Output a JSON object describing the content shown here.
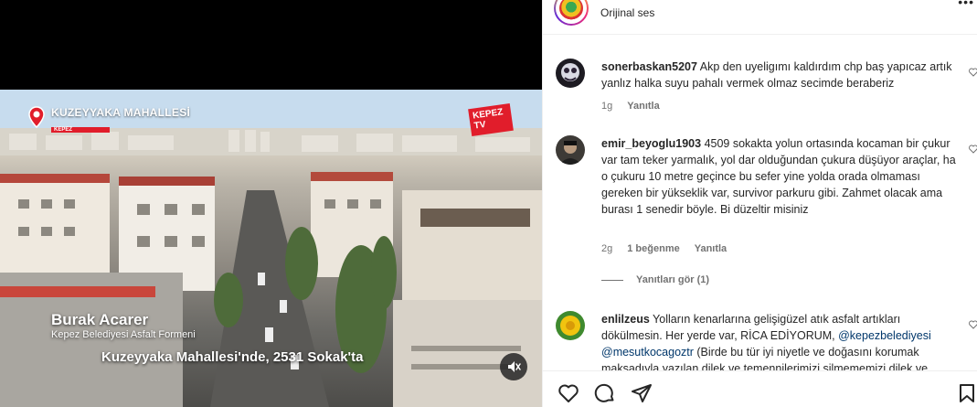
{
  "video": {
    "location_title": "KUZEYYAKA MAHALLESİ",
    "location_sub": "KEPEZ",
    "tv_logo_line1": "KEPEZ",
    "tv_logo_line2": "TV",
    "speaker_name": "Burak Acarer",
    "speaker_role": "Kepez Belediyesi Asfalt Formeni",
    "caption": "Kuzeyyaka Mahallesi'nde, 2531 Sokak'ta"
  },
  "header": {
    "audio_label": "Orijinal ses"
  },
  "comments": [
    {
      "username": "sonerbaskan5207",
      "text": "Akp den uyeligımı kaldırdım chp baş yapıcaz artık yanlız halka suyu pahalı vermek olmaz secimde beraberiz",
      "time": "1g",
      "reply_label": "Yanıtla"
    },
    {
      "username": "emir_beyoglu1903",
      "text": "4509 sokakta yolun ortasında kocaman bir çukur var tam teker yarmalık, yol dar olduğundan çukura düşüyor araçlar, ha o çukuru 10 metre geçince bu sefer yine yolda orada olmaması gereken bir yükseklik var, survivor parkuru gibi. Zahmet olacak ama burası 1 senedir böyle. Bi düzeltir misiniz",
      "time": "2g",
      "likes": "1 beğenme",
      "reply_label": "Yanıtla",
      "see_replies": "Yanıtları gör (1)"
    },
    {
      "username": "enlilzeus",
      "text_before": "Yolların kenarlarına gelişigüzel atık asfalt artıkları dökülmesin. Her yerde var, RİCA EDİYORUM, ",
      "mention1": "@kepezbelediyesi",
      "mention2": "@mesutkocagoztr",
      "text_after": " (Birde bu tür iyi niyetle ve doğasını korumak maksadıyla yazılan dilek ve temennilerimizi silmememizi dilek ve"
    }
  ],
  "icons": {
    "like": "heart-icon",
    "comment": "comment-icon",
    "share": "paper-plane-icon",
    "save": "bookmark-icon",
    "mute": "speaker-muted-icon",
    "more": "more-icon"
  },
  "colors": {
    "mention": "#00376b",
    "meta": "#737373",
    "brand_red": "#e11d2b"
  }
}
